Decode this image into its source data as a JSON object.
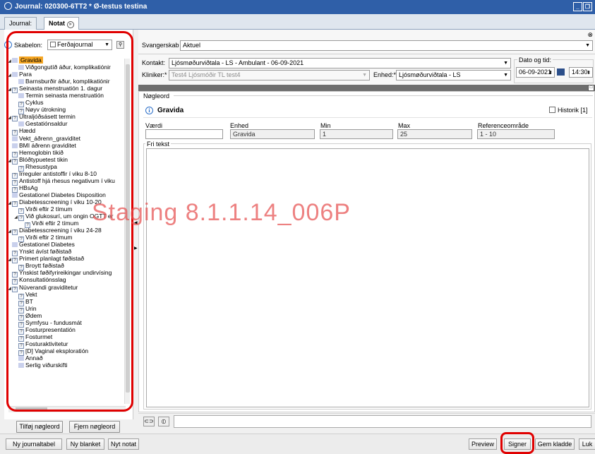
{
  "window": {
    "title": "Journal: 020300-6TT2 * Ø-testus testina"
  },
  "tabs": [
    {
      "label": "Journal:"
    },
    {
      "label": "Notat"
    }
  ],
  "left": {
    "skabelon_label": "Skabelon:",
    "skabelon_value": "Ferðajournal",
    "tree": [
      {
        "t": "toggle",
        "level": 0,
        "icon": "sq",
        "label": "Gravida",
        "selected": true
      },
      {
        "t": "leaf",
        "level": 1,
        "icon": "sq",
        "label": "Viðgongutíð áður, komplikatiónir"
      },
      {
        "t": "toggle",
        "level": 0,
        "icon": "sq",
        "label": "Para"
      },
      {
        "t": "leaf",
        "level": 1,
        "icon": "sq",
        "label": "Barnsburðir áður, komplikatiónir"
      },
      {
        "t": "toggle",
        "level": 0,
        "icon": "q",
        "label": "Seinasta menstruatión 1. dagur"
      },
      {
        "t": "leaf",
        "level": 1,
        "icon": "sq",
        "label": "Termin seinasta menstruatión"
      },
      {
        "t": "leaf",
        "level": 1,
        "icon": "q",
        "label": "Cyklus"
      },
      {
        "t": "leaf",
        "level": 1,
        "icon": "q",
        "label": "Nøyv útrokning"
      },
      {
        "t": "toggle",
        "level": 0,
        "icon": "q",
        "label": "Ultraljóðsásett termin"
      },
      {
        "t": "leaf",
        "level": 1,
        "icon": "sq",
        "label": "Gestatiónsaldur"
      },
      {
        "t": "leaf",
        "level": 0,
        "icon": "q",
        "label": "Hædd"
      },
      {
        "t": "leaf",
        "level": 0,
        "icon": "sq",
        "label": "Vekt_áðrenn_graviditet"
      },
      {
        "t": "leaf",
        "level": 0,
        "icon": "sq",
        "label": "BMI áðrenn graviditet"
      },
      {
        "t": "leaf",
        "level": 0,
        "icon": "q",
        "label": "Hemoglobin tikið"
      },
      {
        "t": "toggle",
        "level": 0,
        "icon": "q",
        "label": "Blóðtypuetest tikin"
      },
      {
        "t": "leaf",
        "level": 1,
        "icon": "q",
        "label": "Rhesustypa"
      },
      {
        "t": "leaf",
        "level": 0,
        "icon": "q",
        "label": "Irreguler antistoffir í viku 8-10"
      },
      {
        "t": "leaf",
        "level": 0,
        "icon": "q",
        "label": "Antistoff hjá rhesus negativum í viku"
      },
      {
        "t": "leaf",
        "level": 0,
        "icon": "q",
        "label": "HBsAg"
      },
      {
        "t": "leaf",
        "level": 0,
        "icon": "sq",
        "label": "Gestationel Diabetes Disposition"
      },
      {
        "t": "toggle",
        "level": 0,
        "icon": "q",
        "label": "Diabetesscreening í viku 10-20"
      },
      {
        "t": "leaf",
        "level": 1,
        "icon": "q",
        "label": "Virði eftir 2 tímum"
      },
      {
        "t": "toggle",
        "level": 1,
        "icon": "q",
        "label": "Við glukosurí, um ongin OGTT er"
      },
      {
        "t": "leaf",
        "level": 2,
        "icon": "q",
        "label": "Virði eftir 2 tímum"
      },
      {
        "t": "toggle",
        "level": 0,
        "icon": "q",
        "label": "Diabetesscreening í viku 24-28"
      },
      {
        "t": "leaf",
        "level": 1,
        "icon": "q",
        "label": "Virði eftir 2 tímum"
      },
      {
        "t": "leaf",
        "level": 0,
        "icon": "sq",
        "label": "Gestationel Diabetes"
      },
      {
        "t": "leaf",
        "level": 0,
        "icon": "q",
        "label": "Ynskt ávíst føðistað"
      },
      {
        "t": "toggle",
        "level": 0,
        "icon": "q",
        "label": "Primert planlagt føðistað"
      },
      {
        "t": "leaf",
        "level": 1,
        "icon": "q",
        "label": "Broytt føðistað"
      },
      {
        "t": "leaf",
        "level": 0,
        "icon": "q",
        "label": "Ynskist føðifyrireikingar undirvísing"
      },
      {
        "t": "leaf",
        "level": 0,
        "icon": "q",
        "label": "Konsultatiónsslag"
      },
      {
        "t": "toggle",
        "level": 0,
        "icon": "q",
        "label": "Núverandi graviditetur"
      },
      {
        "t": "leaf",
        "level": 1,
        "icon": "q",
        "label": "Vekt"
      },
      {
        "t": "leaf",
        "level": 1,
        "icon": "q",
        "label": "BT"
      },
      {
        "t": "leaf",
        "level": 1,
        "icon": "q",
        "label": "Urin"
      },
      {
        "t": "leaf",
        "level": 1,
        "icon": "q",
        "label": "Ødem"
      },
      {
        "t": "leaf",
        "level": 1,
        "icon": "q",
        "label": "Symfysu - fundusmát"
      },
      {
        "t": "leaf",
        "level": 1,
        "icon": "q",
        "label": "Fosturpresentatión"
      },
      {
        "t": "leaf",
        "level": 1,
        "icon": "q",
        "label": "Fosturmet"
      },
      {
        "t": "leaf",
        "level": 1,
        "icon": "q",
        "label": "Fosturaktivitetur"
      },
      {
        "t": "leaf",
        "level": 1,
        "icon": "q",
        "label": "[D] Vaginal eksploratión"
      },
      {
        "t": "leaf",
        "level": 1,
        "icon": "sq",
        "label": "Annað"
      },
      {
        "t": "leaf",
        "level": 1,
        "icon": "sq",
        "label": "Serlig viðurskifti"
      }
    ],
    "add_keyword": "Tilføj nøgleord",
    "remove_keyword": "Fjern nøgleord"
  },
  "right": {
    "svangerskab_label": "Svangerskab",
    "svangerskab_value": "Aktuel",
    "kontakt_label": "Kontakt:",
    "kontakt_value": "Ljósmøðurviðtala - LS - Ambulant - 06-09-2021",
    "dato_label": "Dato og tid:",
    "date_value": "06-09-2021",
    "time_value": "14:30",
    "kliniker_label": "Kliniker:*",
    "kliniker_value": "Test4 Ljósmóðir TL test4",
    "enhed_label": "Enhed:*",
    "enhed_value": "Ljósmøðurviðtala - LS",
    "nogleord_legend": "Nøgleord",
    "keyword_title": "Gravida",
    "historik_label": "Historik [1]",
    "col_vaerdi": "Værdi",
    "col_enhed": "Enhed",
    "col_min": "Min",
    "col_max": "Max",
    "col_ref": "Referenceområde",
    "val_enhed": "Gravida",
    "val_min": "1",
    "val_max": "25",
    "val_ref": "1 - 10",
    "fri_tekst_legend": "Fri tekst"
  },
  "watermark": "Staging 8.1.1.14_006P",
  "footer": {
    "ny_journaltabel": "Ny journaltabel",
    "ny_blanket": "Ny blanket",
    "nyt_notat": "Nyt notat",
    "preview": "Preview",
    "signer": "Signer",
    "gem_kladde": "Gem kladde",
    "luk": "Luk"
  }
}
